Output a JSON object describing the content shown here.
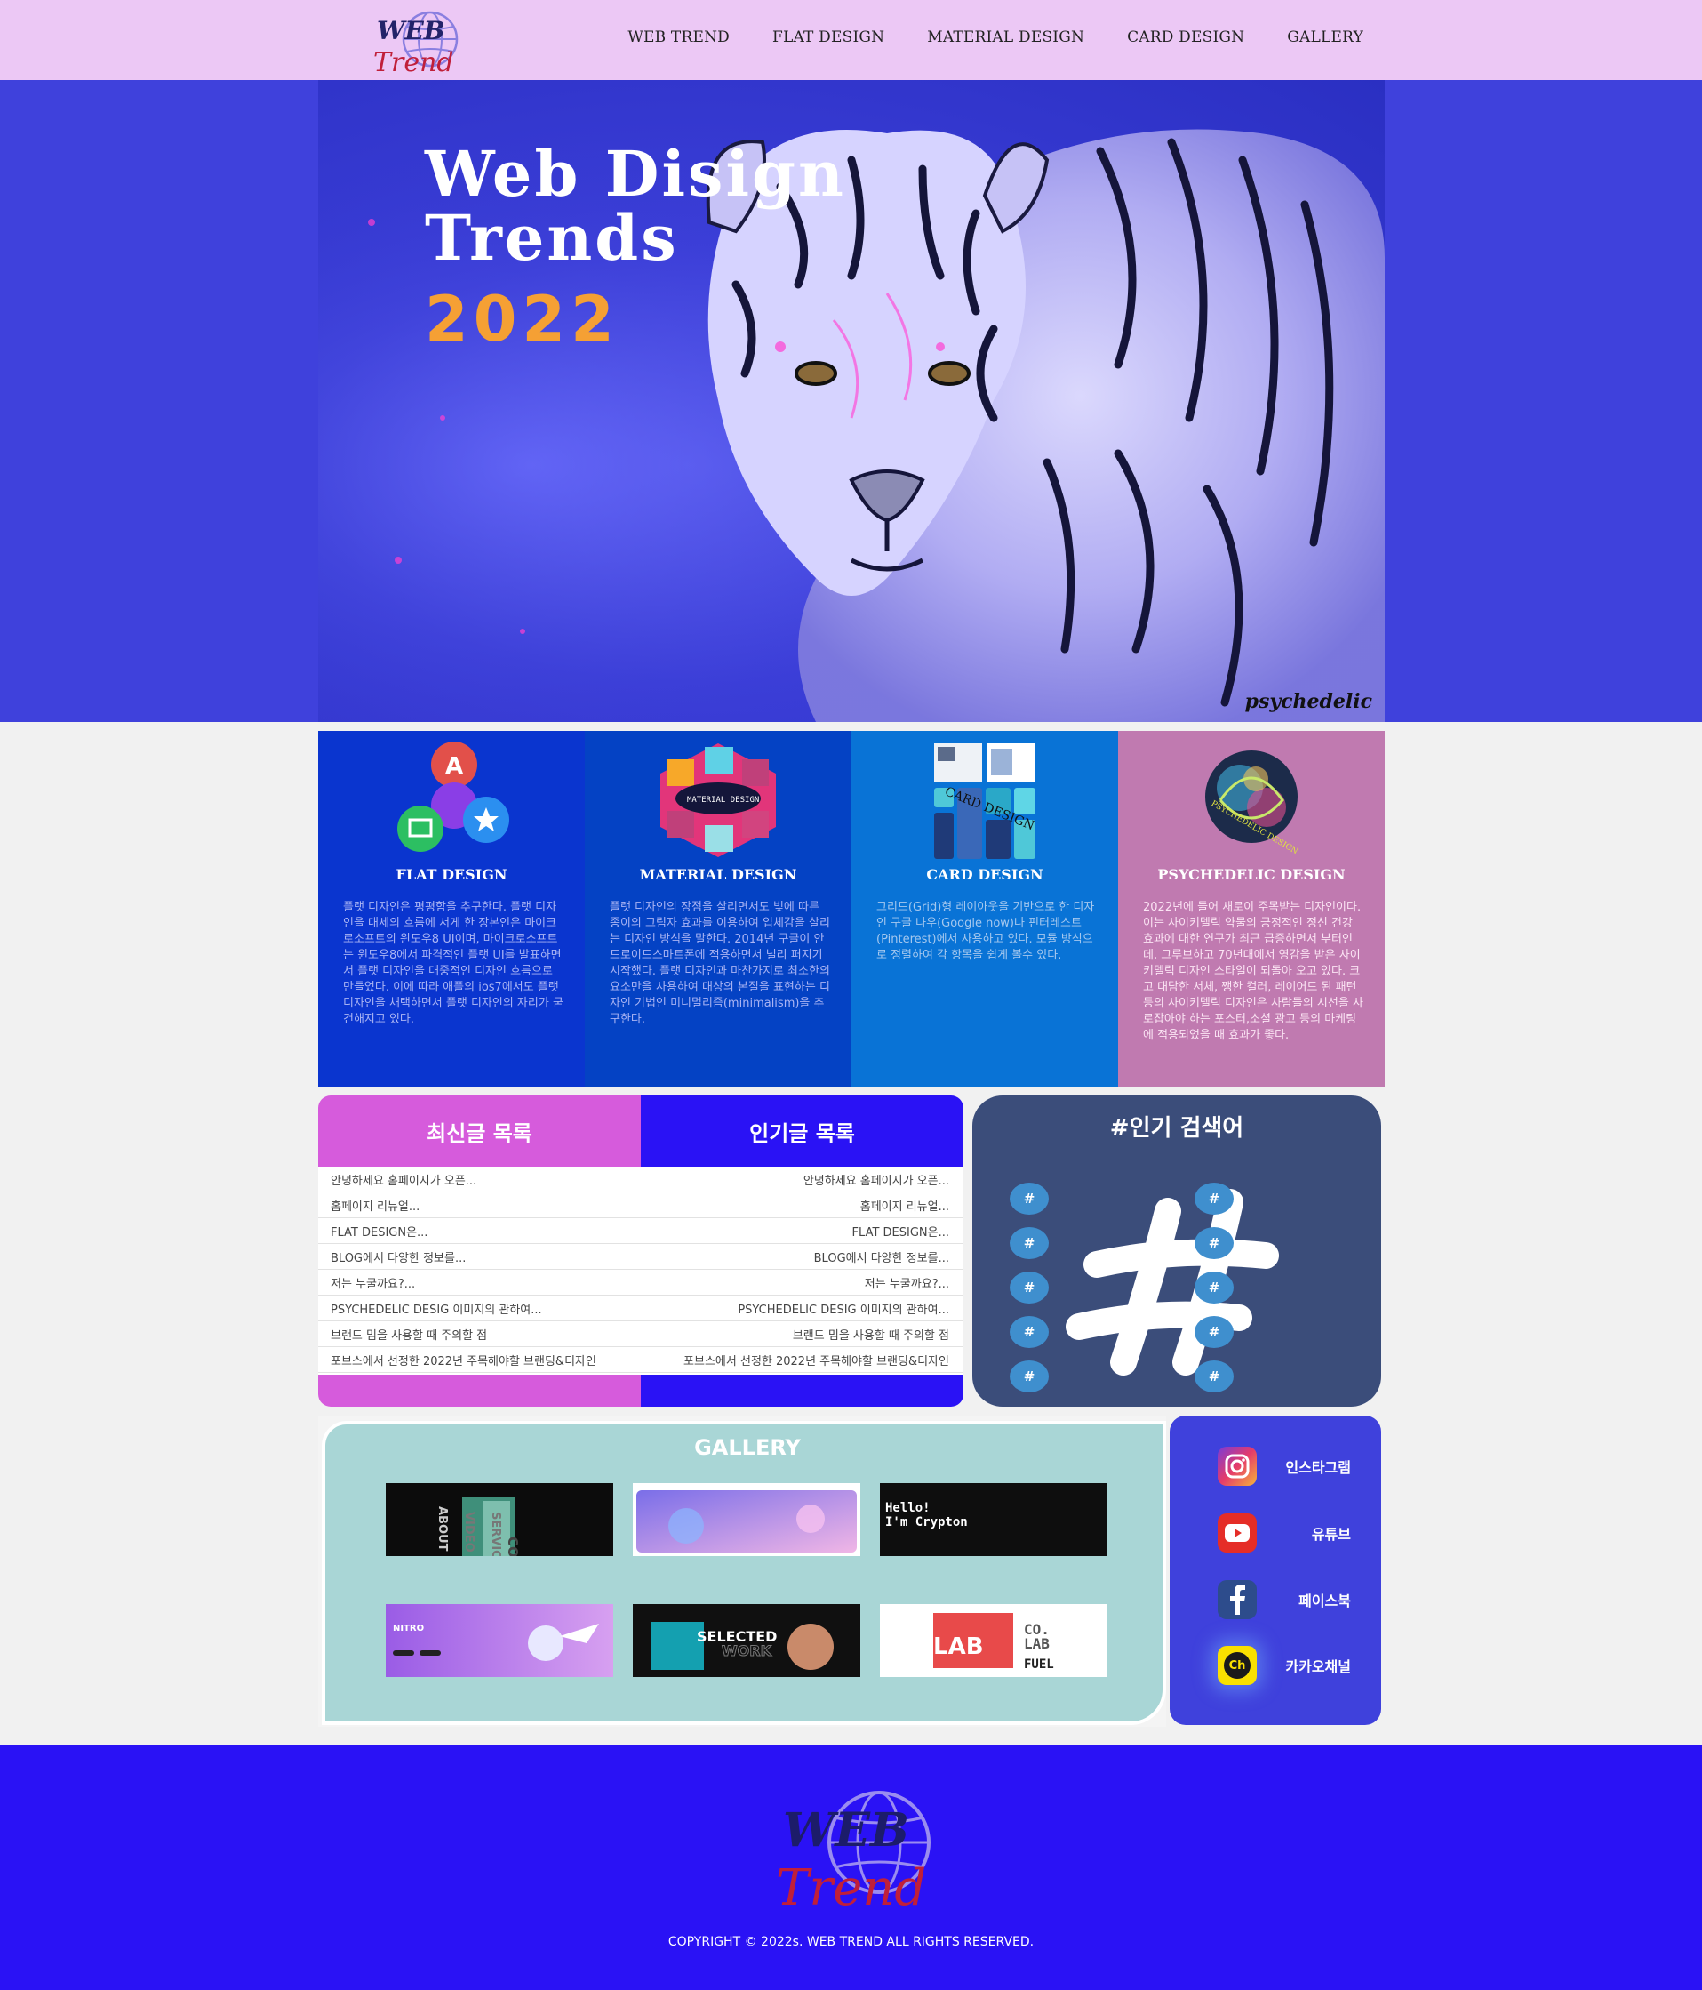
{
  "header": {
    "logo_text_top": "WEB",
    "logo_text_bottom": "Trend",
    "nav": [
      "WEB TREND",
      "FLAT DESIGN",
      "MATERIAL DESIGN",
      "CARD DESIGN",
      "GALLERY"
    ]
  },
  "hero": {
    "title": "Web Disign\nTrends",
    "year": "2022",
    "signature": "psychedelic"
  },
  "cards": [
    {
      "title": "FLAT DESIGN",
      "icon": "flat-design-badges-icon",
      "text": "플랫 디자인은 평평함을 추구한다. 플랫 디자인을 대세의 흐름에 서게 한 장본인은 마이크로소프트의 윈도우8 UI이며, 마이크로소프트는 윈도우8에서 파격적인 플랫 UI를 발표하면서 플랫 디자인을 대중적인 디자인 흐름으로 만들었다. 이에 따라 애플의 ios7에서도 플랫 디자인을 채택하면서 플랫 디자인의 자리가 굳건해지고 있다."
    },
    {
      "title": "MATERIAL DESIGN",
      "icon": "material-design-tiles-icon",
      "text": "플랫 디자인의 장점을 살리면서도 빛에 따른 종이의 그림자 효과를 이용하여 입체감을 살리는 디자인 방식을 말한다. 2014년 구글이 안드로이드스마트폰에 적용하면서 널리 퍼지기 시작했다. 플랫 디자인과 마찬가지로 최소한의 요소만을 사용하여 대상의 본질을 표현하는 디자인 기법인 미니멀리즘(minimalism)을 추구한다."
    },
    {
      "title": "CARD DESIGN",
      "icon": "card-design-grid-icon",
      "text": "그리드(Grid)형 레이아웃을 기반으로 한 디자인 구글 나우(Google now)나 핀터레스트(Pinterest)에서 사용하고 있다. 모듈 방식으로 정렬하여 각 항목을 쉽게 볼수 있다."
    },
    {
      "title": "PSYCHEDELIC DESIGN",
      "icon": "psychedelic-design-orb-icon",
      "text": "2022년에 들어 새로이 주목받는 디자인이다. 이는 사이키델릭 약물의 긍정적인 정신 건강 효과에 대한 연구가 최근 급증하면서 부터인데, 그루브하고 70년대에서 영감을 받은 사이키델릭 디자인 스타일이 되돌아 오고 있다. 크고 대담한 서체, 쨍한 컬러, 레이어드 된 패턴 등의 사이키델릭 디자인은 사람들의 시선을 사로잡아야 하는 포스터,소셜 광고 등의 마케팅에 적용되었을 때 효과가 좋다."
    }
  ],
  "posts": {
    "latest_tab": "최신글 목록",
    "popular_tab": "인기글 목록",
    "rows": [
      {
        "left": "안녕하세요 홈페이지가 오픈...",
        "right": "안녕하세요 홈페이지가 오픈..."
      },
      {
        "left": "홈페이지 리뉴얼...",
        "right": "홈페이지 리뉴얼..."
      },
      {
        "left": "FLAT DESIGN은...",
        "right": "FLAT DESIGN은..."
      },
      {
        "left": "BLOG에서 다양한 정보를...",
        "right": "BLOG에서 다양한 정보를..."
      },
      {
        "left": "저는 누굴까요?...",
        "right": "저는 누굴까요?..."
      },
      {
        "left": "PSYCHEDELIC DESIG 이미지의 관하여...",
        "right": "PSYCHEDELIC DESIG 이미지의 관하여..."
      },
      {
        "left": "브랜드 밈을 사용할 때 주의할 점",
        "right": "브랜드 밈을 사용할 때 주의할 점"
      },
      {
        "left": "포브스에서 선정한 2022년 주목해야할 브랜딩&디자인",
        "right": "포브스에서 선정한 2022년 주목해야할 브랜딩&디자인"
      }
    ]
  },
  "keywords": {
    "title": "#인기 검색어",
    "tags": [
      "#",
      "#",
      "#",
      "#",
      "#",
      "#",
      "#",
      "#",
      "#",
      "#"
    ]
  },
  "gallery": {
    "title": "GALLERY",
    "thumbs": [
      {
        "name": "gallery-thumb-1",
        "labels": [
          "ABOUT",
          "VIDEO",
          "SERVICES",
          "CONTACT"
        ]
      },
      {
        "name": "gallery-thumb-2",
        "labels": []
      },
      {
        "name": "gallery-thumb-3",
        "labels": [
          "Hello!",
          "I'm Crypton"
        ]
      },
      {
        "name": "gallery-thumb-4",
        "labels": [
          "NITRO"
        ]
      },
      {
        "name": "gallery-thumb-5",
        "labels": [
          "SELECTED",
          "WORK"
        ]
      },
      {
        "name": "gallery-thumb-6",
        "labels": [
          "LAB",
          "CO.",
          "LAB",
          "FUEL"
        ]
      }
    ]
  },
  "social": [
    {
      "label": "인스타그램",
      "icon": "instagram-icon"
    },
    {
      "label": "유튜브",
      "icon": "youtube-icon"
    },
    {
      "label": "페이스북",
      "icon": "facebook-icon"
    },
    {
      "label": "카카오채널",
      "icon": "kakao-channel-icon",
      "icon_text": "Ch"
    }
  ],
  "footer": {
    "logo_text_top": "WEB",
    "logo_text_bottom": "Trend",
    "copyright": "COPYRIGHT © 2022s. WEB TREND ALL RIGHTS RESERVED."
  },
  "colors": {
    "header_bg": "#ecc8f5",
    "hero_bg": "#3f41dc",
    "year": "#f5a034",
    "latest_tab": "#d65bdc",
    "popular_tab": "#2a12f5",
    "keywords_bg": "#3b4d7a",
    "gallery_bg": "#a9d6d6",
    "footer_bg": "#2a12f5"
  }
}
